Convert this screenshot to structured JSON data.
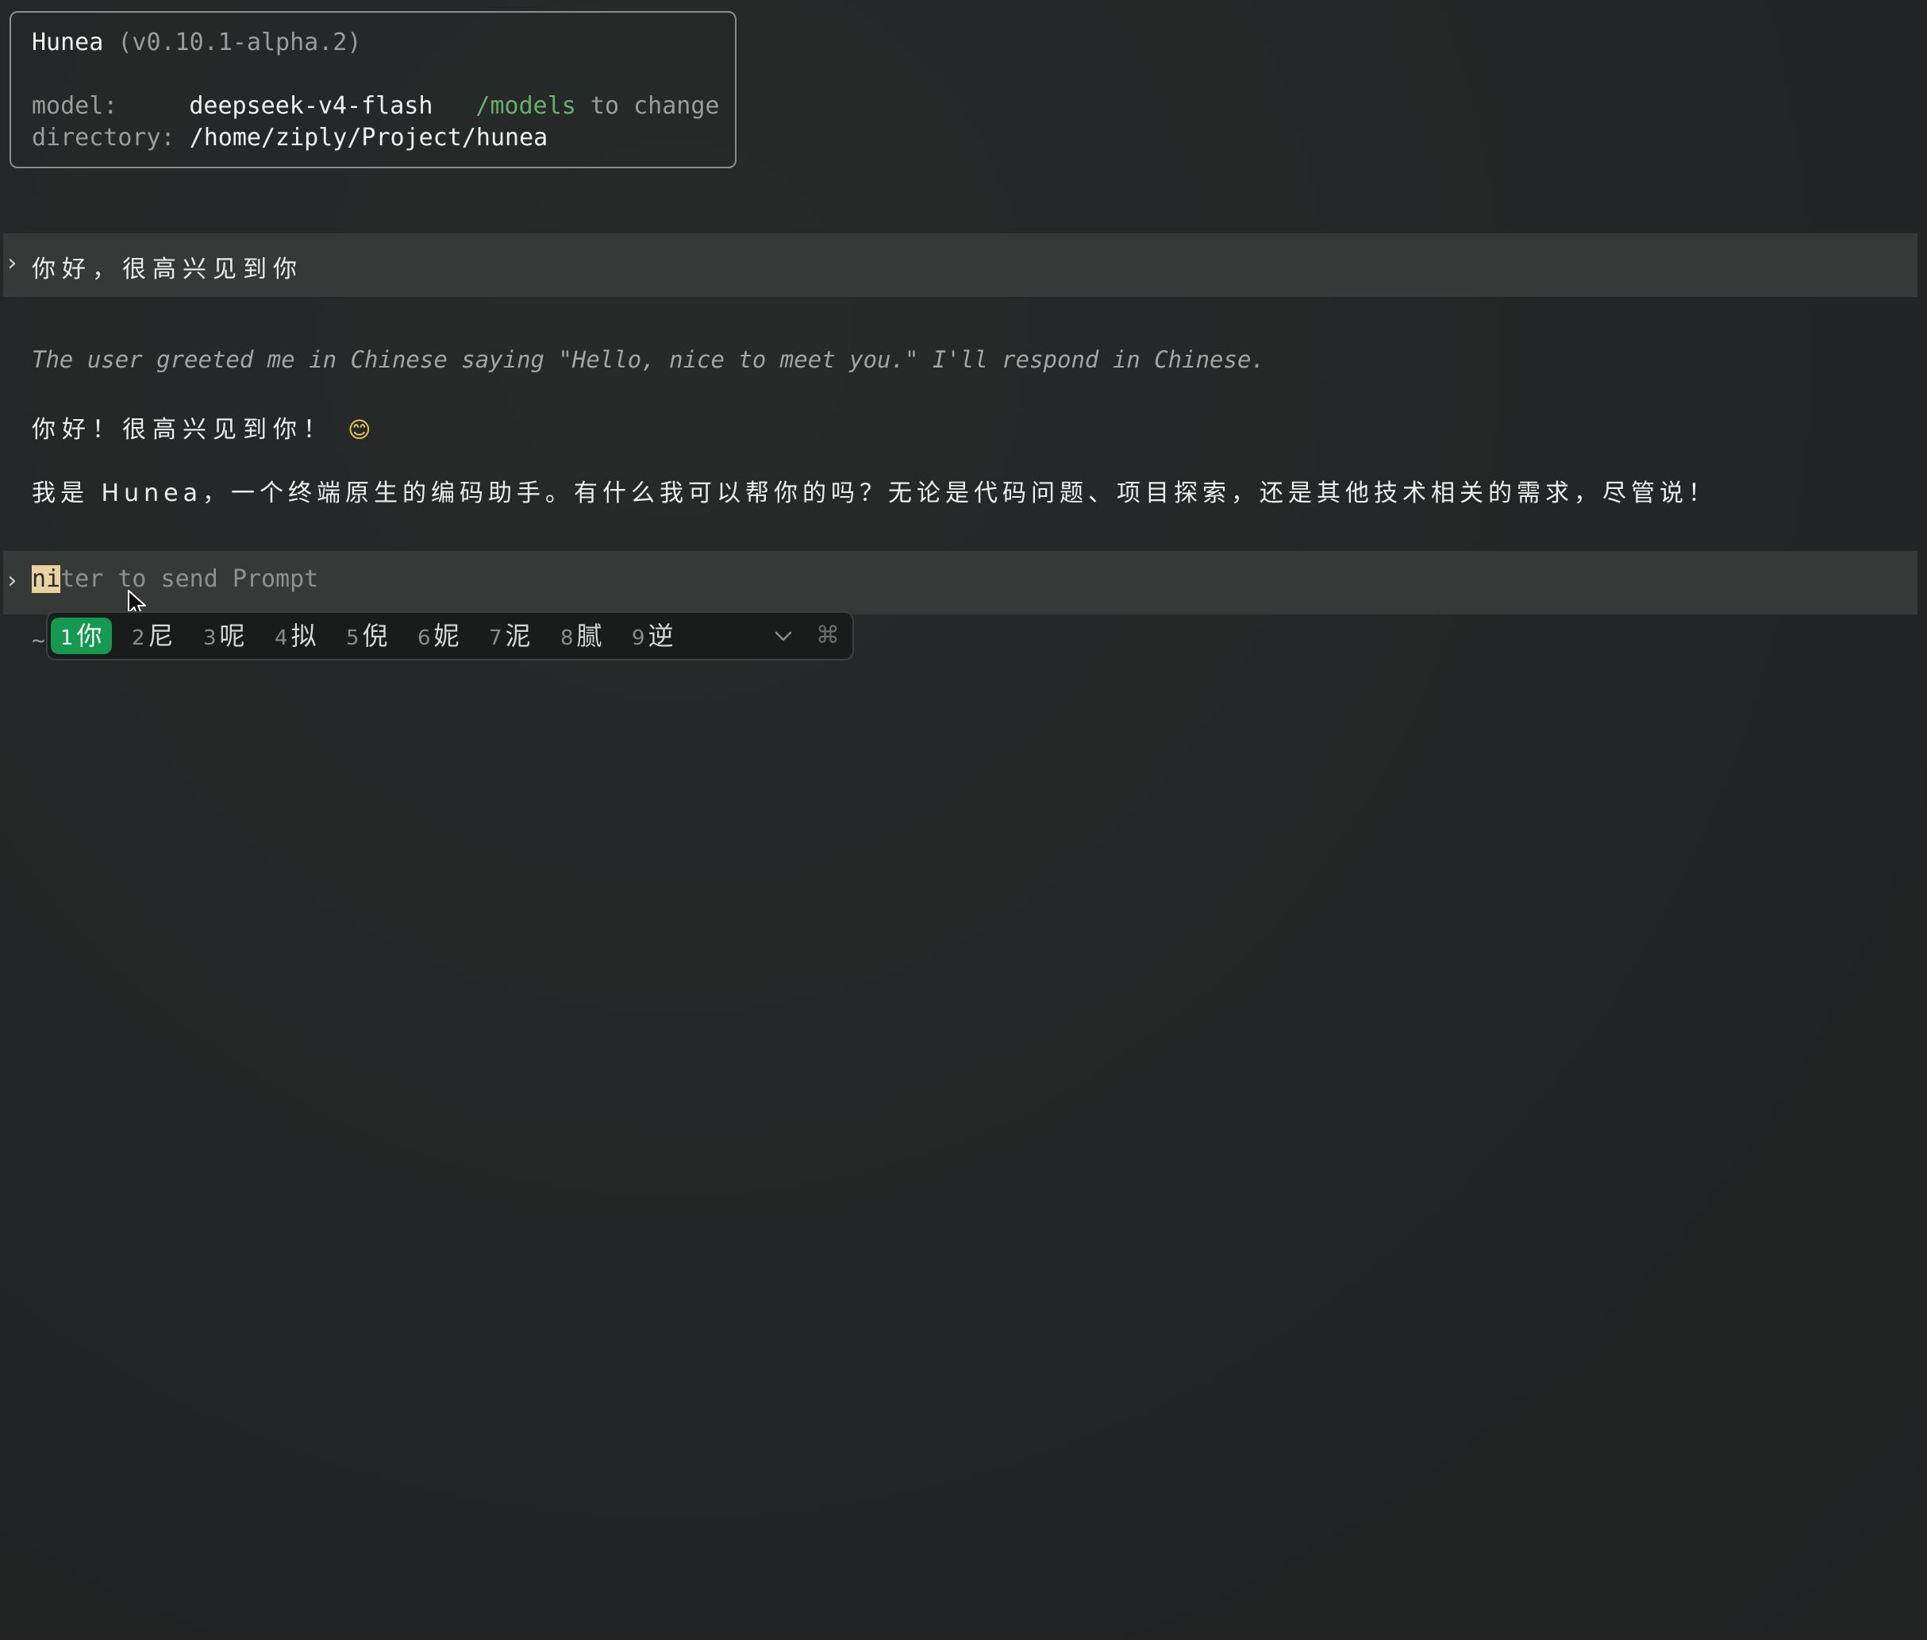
{
  "header": {
    "app_name": "Hunea",
    "version": "(v0.10.1-alpha.2)",
    "model_label": "model:",
    "model_value": "deepseek-v4-flash",
    "models_command": "/models",
    "models_hint": " to change",
    "directory_label": "directory:",
    "directory_value": "/home/ziply/Project/hunea"
  },
  "conversation": {
    "user_prompt_marker": "›",
    "user_message": "你好，很高兴见到你",
    "thinking": "The user greeted me in Chinese saying \"Hello, nice to meet you.\" I'll respond in Chinese.",
    "reply_line1": "你好！很高兴见到你！",
    "reply_emoji": "😊",
    "reply_line2": "我是 Hunea，一个终端原生的编码助手。有什么我可以帮你的吗？无论是代码问题、项目探索，还是其他技术相关的需求，尽管说！"
  },
  "input": {
    "prompt_marker": "›",
    "composing_text": "ni",
    "placeholder_rest": "ter to send Prompt",
    "tilde": "~"
  },
  "ime": {
    "candidates": [
      {
        "num": "1",
        "text": "你",
        "selected": true
      },
      {
        "num": "2",
        "text": "尼"
      },
      {
        "num": "3",
        "text": "呢"
      },
      {
        "num": "4",
        "text": "拟"
      },
      {
        "num": "5",
        "text": "倪"
      },
      {
        "num": "6",
        "text": "妮"
      },
      {
        "num": "7",
        "text": "泥"
      },
      {
        "num": "8",
        "text": "腻"
      },
      {
        "num": "9",
        "text": "逆"
      }
    ],
    "expand_icon": "chevron-down-icon",
    "command_icon": "command-key-icon",
    "command_glyph": "⌘"
  },
  "colors": {
    "background": "#232626",
    "band": "#363938",
    "accent_green": "#67b06b",
    "ime_selected": "#139a4f",
    "composing_highlight": "#e8d3a0"
  }
}
